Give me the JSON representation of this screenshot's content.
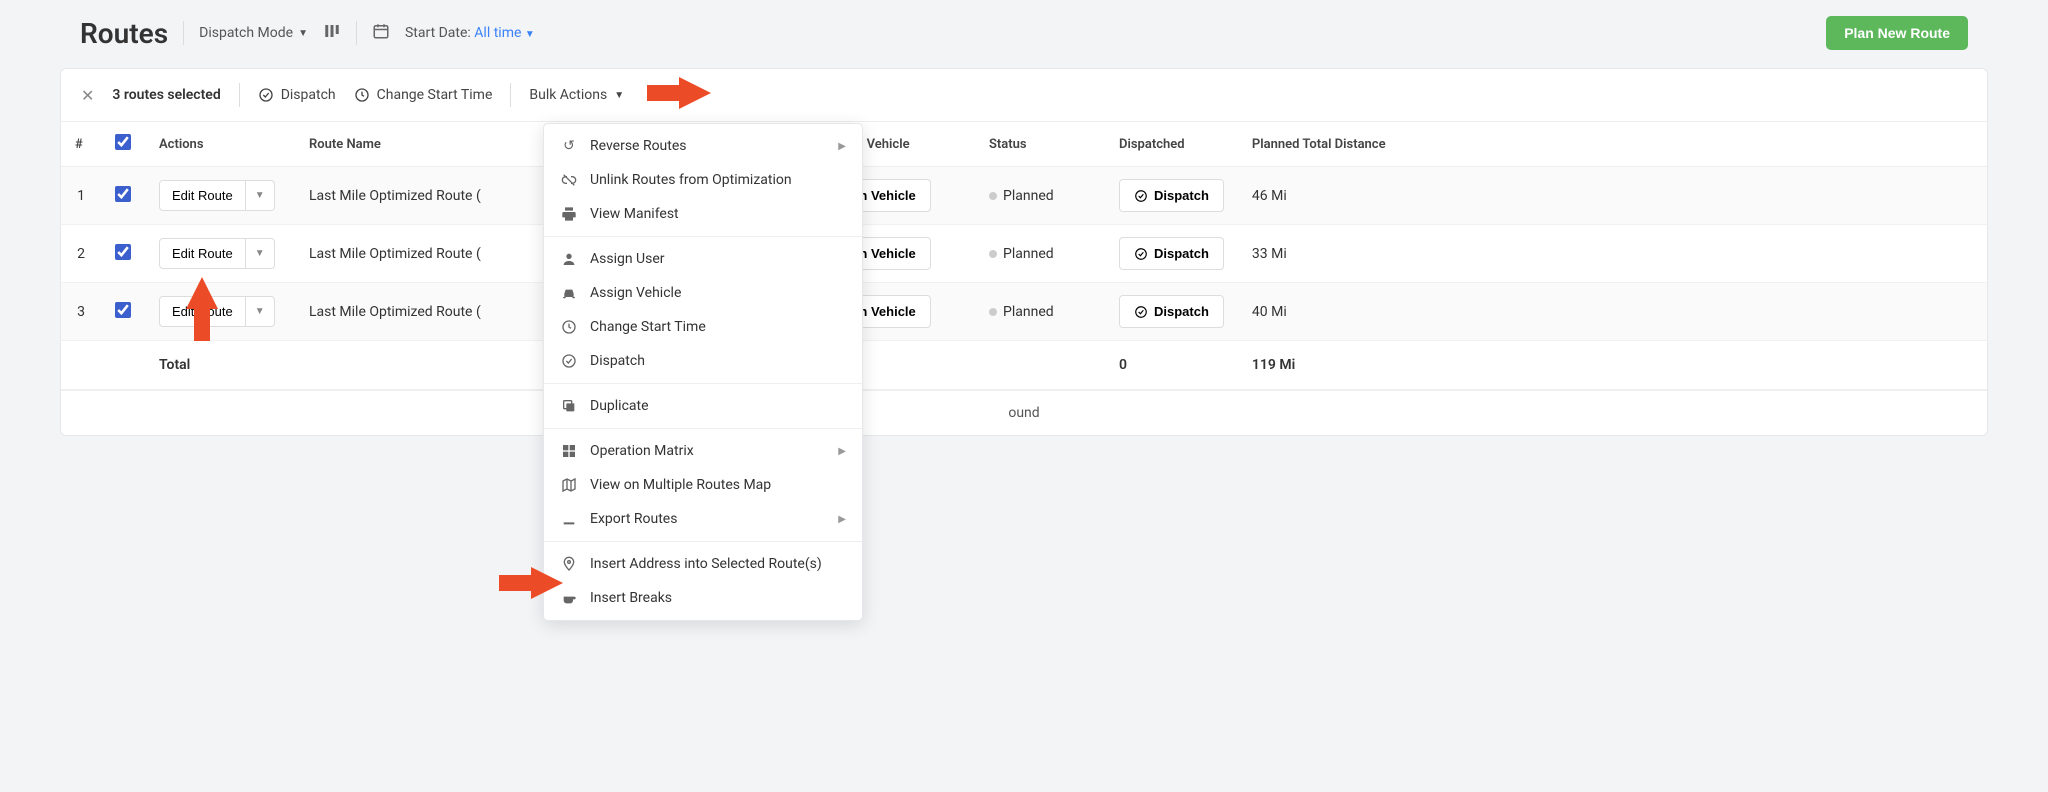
{
  "header": {
    "title": "Routes",
    "mode_label": "Dispatch Mode",
    "date_label": "Start Date:",
    "date_value": "All time",
    "plan_button": "Plan New Route"
  },
  "filter": {
    "selected_text": "3 routes selected",
    "dispatch": "Dispatch",
    "change_time": "Change Start Time",
    "bulk_actions": "Bulk Actions"
  },
  "columns": {
    "num": "#",
    "actions": "Actions",
    "route_name": "Route Name",
    "assigned_vehicle": "Assigned Vehicle",
    "status": "Status",
    "dispatched": "Dispatched",
    "total_distance": "Planned Total Distance"
  },
  "rows": [
    {
      "num": "1",
      "edit": "Edit Route",
      "name": "Last Mile Optimized Route (",
      "assign": "Assign Vehicle",
      "status": "Planned",
      "dispatch": "Dispatch",
      "distance": "46 Mi"
    },
    {
      "num": "2",
      "edit": "Edit Route",
      "name": "Last Mile Optimized Route (",
      "assign": "Assign Vehicle",
      "status": "Planned",
      "dispatch": "Dispatch",
      "distance": "33 Mi"
    },
    {
      "num": "3",
      "edit": "Edit Route",
      "name": "Last Mile Optimized Route (",
      "assign": "Assign Vehicle",
      "status": "Planned",
      "dispatch": "Dispatch",
      "distance": "40 Mi"
    }
  ],
  "total": {
    "label": "Total",
    "count": "0",
    "distance": "119 Mi"
  },
  "results_msg": "ound",
  "dropdown": {
    "reverse": "Reverse Routes",
    "unlink": "Unlink Routes from Optimization",
    "manifest": "View Manifest",
    "assign_user": "Assign User",
    "assign_vehicle": "Assign Vehicle",
    "change_time": "Change Start Time",
    "dispatch": "Dispatch",
    "duplicate": "Duplicate",
    "op_matrix": "Operation Matrix",
    "multi_map": "View on Multiple Routes Map",
    "export": "Export Routes",
    "insert_addr": "Insert Address into Selected Route(s)",
    "insert_breaks": "Insert Breaks"
  }
}
